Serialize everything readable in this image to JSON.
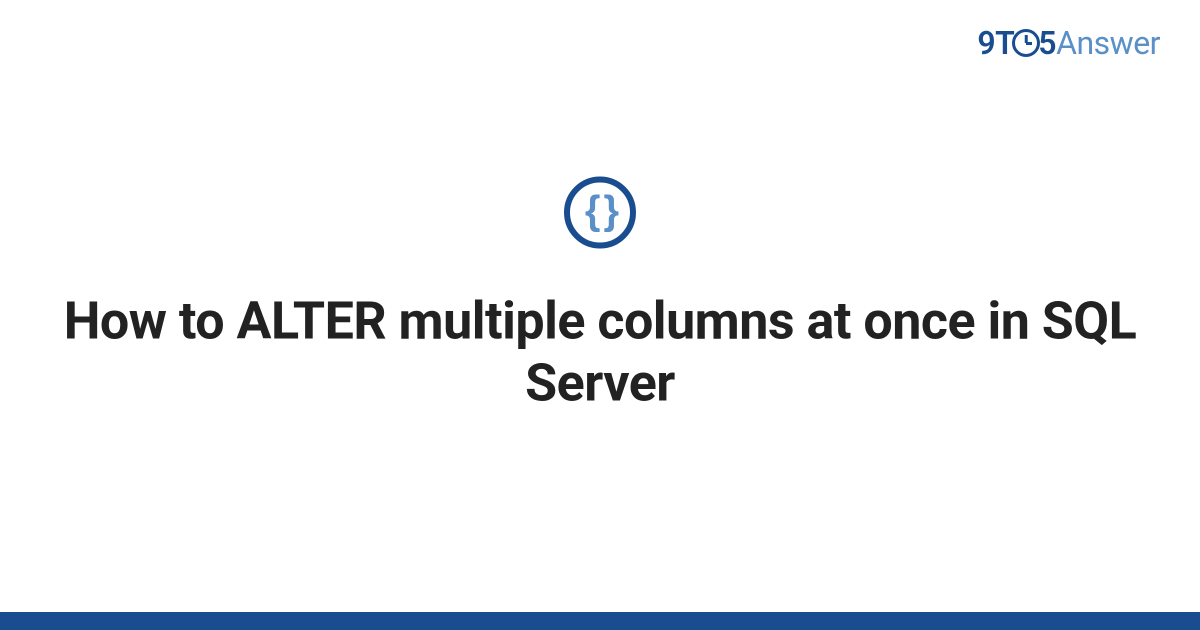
{
  "logo": {
    "part1": "9T",
    "part2": "5",
    "part3": "Answer"
  },
  "icon": {
    "braces": "{ }"
  },
  "title": "How to ALTER multiple columns at once in SQL Server"
}
